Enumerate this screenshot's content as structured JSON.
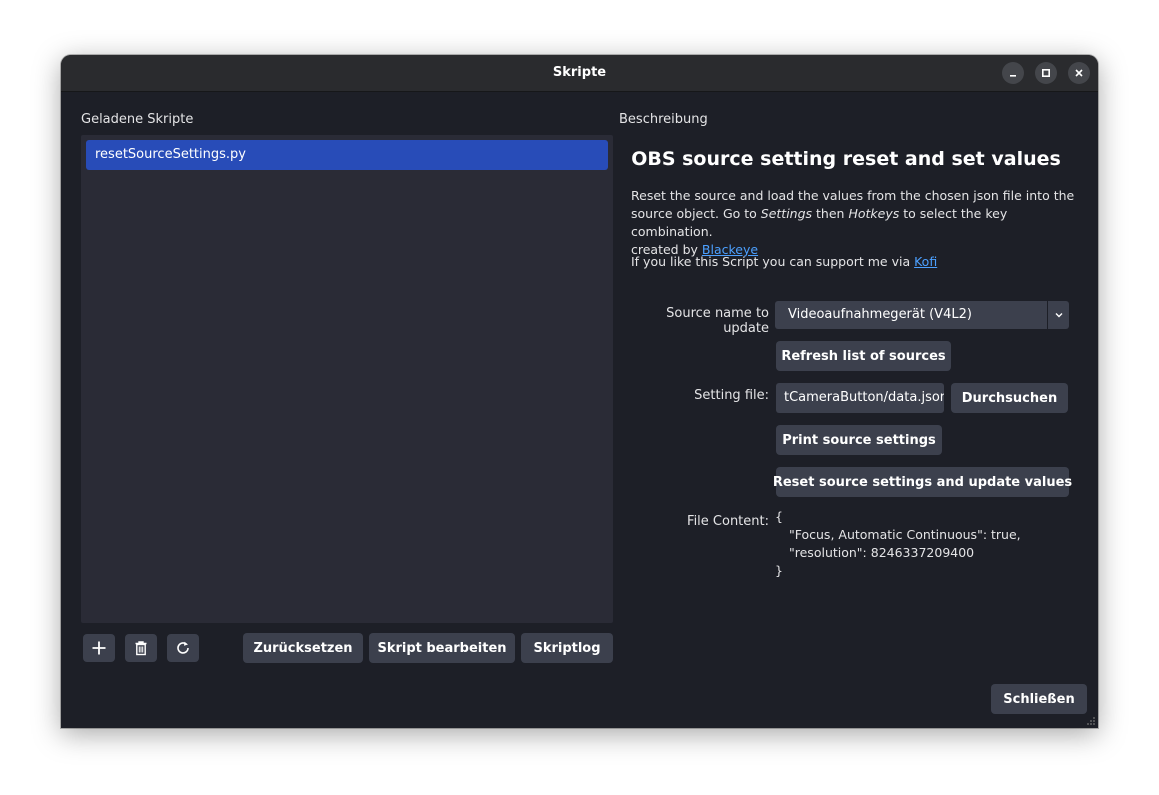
{
  "window": {
    "title": "Skripte"
  },
  "left": {
    "label": "Geladene Skripte",
    "scripts": [
      "resetSourceSettings.py"
    ],
    "buttons": {
      "add_icon": "plus-icon",
      "remove_icon": "trash-icon",
      "reload_icon": "reload-icon",
      "reset": "Zurücksetzen",
      "edit": "Skript bearbeiten",
      "log": "Skriptlog"
    }
  },
  "right": {
    "label": "Beschreibung",
    "heading": "OBS source setting reset and set values",
    "desc": {
      "p1a": "Reset the source and load the values from the chosen json file into the",
      "p1b_pre": "source object. Go to ",
      "p1b_em1": "Settings",
      "p1b_mid": " then ",
      "p1b_em2": "Hotkeys",
      "p1b_post": " to select the key combination.",
      "p1c_pre": "created by ",
      "p1c_link": "Blackeye",
      "p2_pre": "If you like this Script you can support me via ",
      "p2_link": "Kofi"
    },
    "form": {
      "source_label": "Source name to update",
      "source_value": "Videoaufnahmegerät (V4L2)",
      "refresh_button": "Refresh list of sources",
      "setting_label": "Setting file:",
      "setting_value": "tCameraButton/data.json",
      "browse_button": "Durchsuchen",
      "print_button": "Print source settings",
      "reset_button": "Reset source settings and update values",
      "file_content_label": "File Content:",
      "file_content_lines": [
        "{",
        "\"Focus, Automatic Continuous\": true,",
        "\"resolution\": 8246337209400",
        "}"
      ]
    }
  },
  "footer": {
    "close": "Schließen"
  },
  "colors": {
    "window_bg": "#1d1f27",
    "titlebar": "#2a2b2e",
    "button": "#3c404d",
    "selection": "#284cb8",
    "link": "#4ca0ff"
  }
}
